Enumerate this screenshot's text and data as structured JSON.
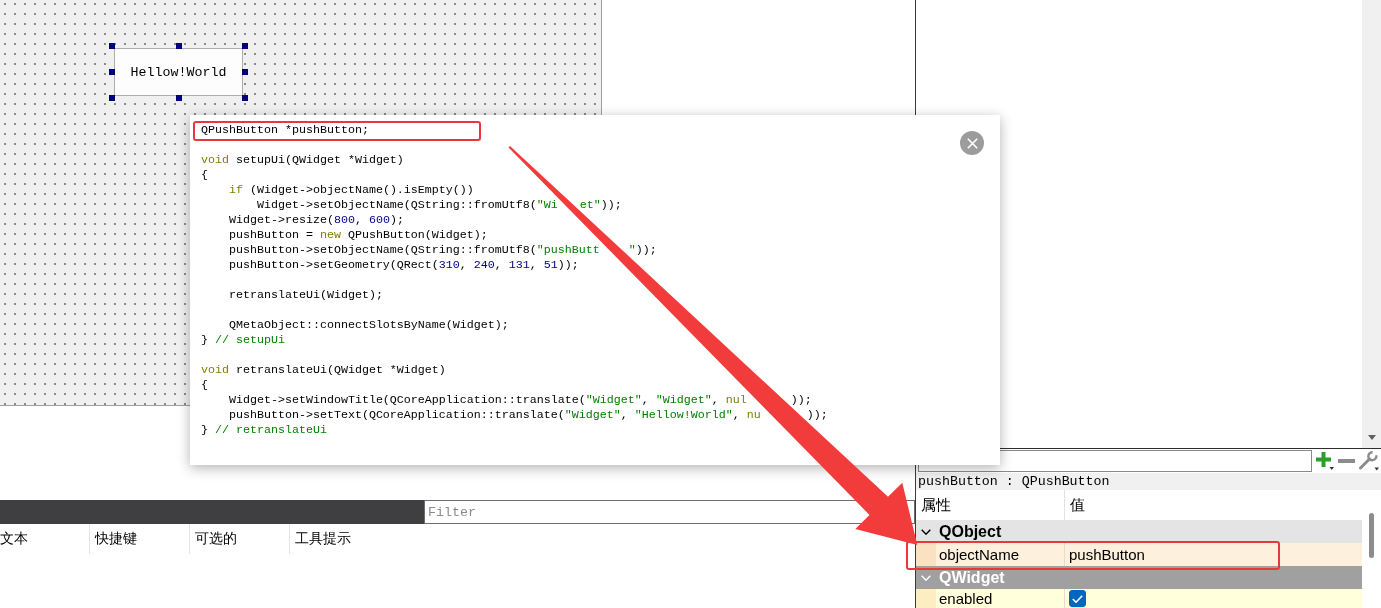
{
  "form": {
    "widgets": [
      {
        "kind": "push_button",
        "text": "Hellow!World",
        "selected": true
      }
    ]
  },
  "code_popup": {
    "blocks": [
      [
        {
          "tokens": [
            {
              "kind": "plain",
              "text": "QPushButton *pushButton;"
            }
          ]
        }
      ],
      [
        {
          "tokens": [
            {
              "kind": "keyword",
              "text": "void"
            },
            {
              "kind": "plain",
              "text": " setupUi(QWidget *Widget)"
            }
          ]
        },
        {
          "tokens": [
            {
              "kind": "plain",
              "text": "{"
            }
          ]
        },
        {
          "tokens": [
            {
              "kind": "keyword",
              "text": "    if"
            },
            {
              "kind": "plain",
              "text": " (Widget->objectName().isEmpty())"
            }
          ]
        },
        {
          "tokens": [
            {
              "kind": "plain",
              "text": "        Widget->setObjectName(QString::fromUtf8("
            },
            {
              "kind": "string",
              "text": "\"Wi"
            }
          ],
          "tail": [
            {
              "kind": "string",
              "text": "et\""
            },
            {
              "kind": "plain",
              "text": "));"
            }
          ]
        },
        {
          "tokens": [
            {
              "kind": "plain",
              "text": "    Widget->resize("
            },
            {
              "kind": "number",
              "text": "800"
            },
            {
              "kind": "plain",
              "text": ", "
            },
            {
              "kind": "number",
              "text": "600"
            },
            {
              "kind": "plain",
              "text": ");"
            }
          ]
        },
        {
          "tokens": [
            {
              "kind": "plain",
              "text": "    pushButton = "
            },
            {
              "kind": "keyword",
              "text": "new"
            },
            {
              "kind": "plain",
              "text": " QPushButton(Widget);"
            }
          ]
        },
        {
          "tokens": [
            {
              "kind": "plain",
              "text": "    pushButton->setObjectName(QString::fromUtf8("
            },
            {
              "kind": "string",
              "text": "\"pushButt"
            }
          ],
          "tail": [
            {
              "kind": "string",
              "text": "\""
            },
            {
              "kind": "plain",
              "text": "));"
            }
          ]
        },
        {
          "tokens": [
            {
              "kind": "plain",
              "text": "    pushButton->setGeometry(QRect("
            },
            {
              "kind": "number",
              "text": "310"
            },
            {
              "kind": "plain",
              "text": ", "
            },
            {
              "kind": "number",
              "text": "240"
            },
            {
              "kind": "plain",
              "text": ", "
            },
            {
              "kind": "number",
              "text": "131"
            },
            {
              "kind": "plain",
              "text": ", "
            },
            {
              "kind": "number",
              "text": "51"
            },
            {
              "kind": "plain",
              "text": "));"
            }
          ]
        }
      ],
      [
        {
          "tokens": [
            {
              "kind": "plain",
              "text": "    retranslateUi(Widget);"
            }
          ]
        }
      ],
      [
        {
          "tokens": [
            {
              "kind": "plain",
              "text": "    QMetaObject::connectSlotsByName(Widget);"
            }
          ]
        },
        {
          "tokens": [
            {
              "kind": "plain",
              "text": "} "
            },
            {
              "kind": "comment",
              "text": "// setupUi"
            }
          ]
        }
      ],
      [
        {
          "tokens": [
            {
              "kind": "keyword",
              "text": "void"
            },
            {
              "kind": "plain",
              "text": " retranslateUi(QWidget *Widget)"
            }
          ]
        },
        {
          "tokens": [
            {
              "kind": "plain",
              "text": "{"
            }
          ]
        },
        {
          "tokens": [
            {
              "kind": "plain",
              "text": "    Widget->setWindowTitle(QCoreApplication::translate("
            },
            {
              "kind": "string",
              "text": "\"Widget\""
            },
            {
              "kind": "plain",
              "text": ", "
            },
            {
              "kind": "string",
              "text": "\"Widget\""
            },
            {
              "kind": "plain",
              "text": ", "
            },
            {
              "kind": "keyword",
              "text": "nul"
            }
          ],
          "tail": [
            {
              "kind": "plain",
              "text": "));"
            }
          ]
        },
        {
          "tokens": [
            {
              "kind": "plain",
              "text": "    pushButton->setText(QCoreApplication::translate("
            },
            {
              "kind": "string",
              "text": "\"Widget\""
            },
            {
              "kind": "plain",
              "text": ", "
            },
            {
              "kind": "string",
              "text": "\"Hellow!World\""
            },
            {
              "kind": "plain",
              "text": ", "
            },
            {
              "kind": "keyword",
              "text": "nu"
            }
          ],
          "tail": [
            {
              "kind": "plain",
              "text": "));"
            }
          ]
        },
        {
          "tokens": [
            {
              "kind": "plain",
              "text": "} "
            },
            {
              "kind": "comment",
              "text": "// retranslateUi"
            }
          ]
        }
      ]
    ]
  },
  "action_editor": {
    "filter": {
      "placeholder": "Filter"
    },
    "columns": [
      "文本",
      "快捷键",
      "可选的",
      "工具提示"
    ]
  },
  "property_editor": {
    "object_label": "pushButton : QPushButton",
    "columns": [
      "属性",
      "值"
    ],
    "groups": [
      {
        "name": "QObject",
        "expanded": true,
        "highlighted": false,
        "color": "#fdf0dc",
        "properties": [
          {
            "kind": "text",
            "name": "objectName",
            "value": "pushButton"
          }
        ]
      },
      {
        "name": "QWidget",
        "expanded": true,
        "highlighted": true,
        "color": "#ffffdc",
        "properties": [
          {
            "kind": "checkbox",
            "name": "enabled",
            "checked": true
          }
        ]
      }
    ]
  },
  "annotations": [
    {
      "kind": "frame"
    },
    {
      "kind": "arrow"
    },
    {
      "kind": "frame"
    }
  ]
}
